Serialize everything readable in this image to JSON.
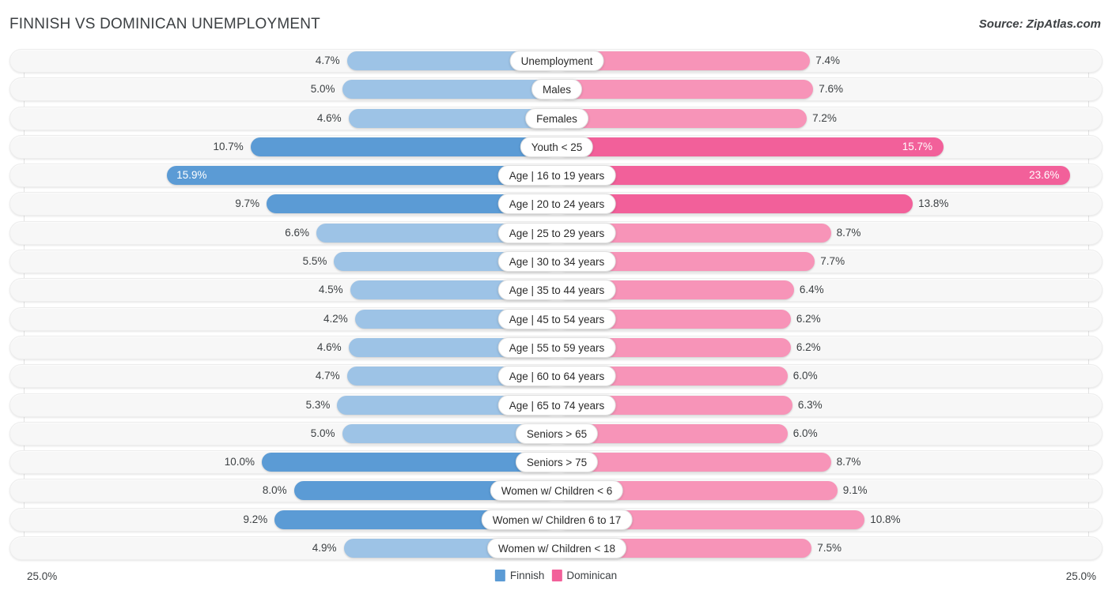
{
  "header": {
    "title": "FINNISH VS DOMINICAN UNEMPLOYMENT",
    "source": "Source: ZipAtlas.com"
  },
  "footer": {
    "axis_left": "25.0%",
    "axis_right": "25.0%",
    "legend": [
      {
        "label": "Finnish",
        "color": "#5b9bd5",
        "swatch": "blue-swatch"
      },
      {
        "label": "Dominican",
        "color": "#f2609a",
        "swatch": "pink-swatch"
      }
    ]
  },
  "chart_data": {
    "type": "bar",
    "orientation": "diverging-horizontal",
    "title": "FINNISH VS DOMINICAN UNEMPLOYMENT",
    "xlabel": "",
    "ylabel": "",
    "xlim": [
      25.0,
      25.0
    ],
    "axis_max_left": 25.0,
    "axis_max_right": 25.0,
    "grid": true,
    "legend_position": "bottom-center",
    "categories": [
      "Unemployment",
      "Males",
      "Females",
      "Youth < 25",
      "Age | 16 to 19 years",
      "Age | 20 to 24 years",
      "Age | 25 to 29 years",
      "Age | 30 to 34 years",
      "Age | 35 to 44 years",
      "Age | 45 to 54 years",
      "Age | 55 to 59 years",
      "Age | 60 to 64 years",
      "Age | 65 to 74 years",
      "Seniors > 65",
      "Seniors > 75",
      "Women w/ Children < 6",
      "Women w/ Children 6 to 17",
      "Women w/ Children < 18"
    ],
    "series": [
      {
        "name": "Finnish",
        "color": "#9dc3e6",
        "highlight_color": "#5b9bd5",
        "values": [
          4.7,
          5.0,
          4.6,
          10.7,
          15.9,
          9.7,
          6.6,
          5.5,
          4.5,
          4.2,
          4.6,
          4.7,
          5.3,
          5.0,
          10.0,
          8.0,
          9.2,
          4.9
        ]
      },
      {
        "name": "Dominican",
        "color": "#f794b8",
        "highlight_color": "#f2609a",
        "values": [
          7.4,
          7.6,
          7.2,
          15.7,
          23.6,
          13.8,
          8.7,
          7.7,
          6.4,
          6.2,
          6.2,
          6.0,
          6.3,
          6.0,
          8.7,
          9.1,
          10.8,
          7.5
        ]
      }
    ],
    "rows": [
      {
        "label": "Unemployment",
        "left_value": 4.7,
        "left_text": "4.7%",
        "right_value": 7.4,
        "right_text": "7.4%",
        "left_highlight": false,
        "right_highlight": false,
        "left_inside": false,
        "right_inside": false
      },
      {
        "label": "Males",
        "left_value": 5.0,
        "left_text": "5.0%",
        "right_value": 7.6,
        "right_text": "7.6%",
        "left_highlight": false,
        "right_highlight": false,
        "left_inside": false,
        "right_inside": false
      },
      {
        "label": "Females",
        "left_value": 4.6,
        "left_text": "4.6%",
        "right_value": 7.2,
        "right_text": "7.2%",
        "left_highlight": false,
        "right_highlight": false,
        "left_inside": false,
        "right_inside": false
      },
      {
        "label": "Youth < 25",
        "left_value": 10.7,
        "left_text": "10.7%",
        "right_value": 15.7,
        "right_text": "15.7%",
        "left_highlight": true,
        "right_highlight": true,
        "left_inside": false,
        "right_inside": true
      },
      {
        "label": "Age | 16 to 19 years",
        "left_value": 15.9,
        "left_text": "15.9%",
        "right_value": 23.6,
        "right_text": "23.6%",
        "left_highlight": true,
        "right_highlight": true,
        "left_inside": true,
        "right_inside": true
      },
      {
        "label": "Age | 20 to 24 years",
        "left_value": 9.7,
        "left_text": "9.7%",
        "right_value": 13.8,
        "right_text": "13.8%",
        "left_highlight": true,
        "right_highlight": true,
        "left_inside": false,
        "right_inside": false
      },
      {
        "label": "Age | 25 to 29 years",
        "left_value": 6.6,
        "left_text": "6.6%",
        "right_value": 8.7,
        "right_text": "8.7%",
        "left_highlight": false,
        "right_highlight": false,
        "left_inside": false,
        "right_inside": false
      },
      {
        "label": "Age | 30 to 34 years",
        "left_value": 5.5,
        "left_text": "5.5%",
        "right_value": 7.7,
        "right_text": "7.7%",
        "left_highlight": false,
        "right_highlight": false,
        "left_inside": false,
        "right_inside": false
      },
      {
        "label": "Age | 35 to 44 years",
        "left_value": 4.5,
        "left_text": "4.5%",
        "right_value": 6.4,
        "right_text": "6.4%",
        "left_highlight": false,
        "right_highlight": false,
        "left_inside": false,
        "right_inside": false
      },
      {
        "label": "Age | 45 to 54 years",
        "left_value": 4.2,
        "left_text": "4.2%",
        "right_value": 6.2,
        "right_text": "6.2%",
        "left_highlight": false,
        "right_highlight": false,
        "left_inside": false,
        "right_inside": false
      },
      {
        "label": "Age | 55 to 59 years",
        "left_value": 4.6,
        "left_text": "4.6%",
        "right_value": 6.2,
        "right_text": "6.2%",
        "left_highlight": false,
        "right_highlight": false,
        "left_inside": false,
        "right_inside": false
      },
      {
        "label": "Age | 60 to 64 years",
        "left_value": 4.7,
        "left_text": "4.7%",
        "right_value": 6.0,
        "right_text": "6.0%",
        "left_highlight": false,
        "right_highlight": false,
        "left_inside": false,
        "right_inside": false
      },
      {
        "label": "Age | 65 to 74 years",
        "left_value": 5.3,
        "left_text": "5.3%",
        "right_value": 6.3,
        "right_text": "6.3%",
        "left_highlight": false,
        "right_highlight": false,
        "left_inside": false,
        "right_inside": false
      },
      {
        "label": "Seniors > 65",
        "left_value": 5.0,
        "left_text": "5.0%",
        "right_value": 6.0,
        "right_text": "6.0%",
        "left_highlight": false,
        "right_highlight": false,
        "left_inside": false,
        "right_inside": false
      },
      {
        "label": "Seniors > 75",
        "left_value": 10.0,
        "left_text": "10.0%",
        "right_value": 8.7,
        "right_text": "8.7%",
        "left_highlight": true,
        "right_highlight": false,
        "left_inside": false,
        "right_inside": false
      },
      {
        "label": "Women w/ Children < 6",
        "left_value": 8.0,
        "left_text": "8.0%",
        "right_value": 9.1,
        "right_text": "9.1%",
        "left_highlight": true,
        "right_highlight": false,
        "left_inside": false,
        "right_inside": false
      },
      {
        "label": "Women w/ Children 6 to 17",
        "left_value": 9.2,
        "left_text": "9.2%",
        "right_value": 10.8,
        "right_text": "10.8%",
        "left_highlight": true,
        "right_highlight": false,
        "left_inside": false,
        "right_inside": false
      },
      {
        "label": "Women w/ Children < 18",
        "left_value": 4.9,
        "left_text": "4.9%",
        "right_value": 7.5,
        "right_text": "7.5%",
        "left_highlight": false,
        "right_highlight": false,
        "left_inside": false,
        "right_inside": false
      }
    ]
  }
}
